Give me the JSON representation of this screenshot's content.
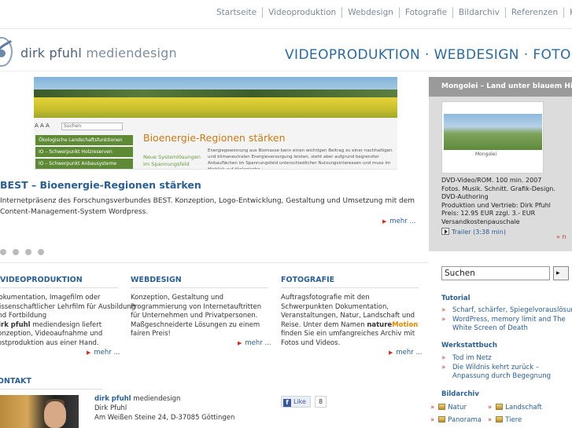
{
  "nav": {
    "items": [
      "Startseite",
      "Videoproduktion",
      "Webdesign",
      "Fotografie",
      "Bildarchiv",
      "Referenzen",
      "Ko"
    ]
  },
  "brand": {
    "name_bold": "dirk pfuhl",
    "name_light": "mediendesign",
    "logo_icon": "leaf-eye-logo"
  },
  "tagline": "VIDEOPRODUKTION · WEBDESIGN · FOTOGRA",
  "banner": {
    "text_size_label": "A A A",
    "search_placeholder": "Suchen",
    "nav_items": [
      "Ökologische Landschaftsfunktionen",
      "IO – Schwerpunkt Holzreserven",
      "IO – Schwerpunkt Anbausysteme"
    ],
    "title": "Bioenergie-Regionen stärken",
    "subtitle": "Neue Systemlösungen im Spannungsfeld",
    "text": "Energiegewinnung aus Biomasse kann einen wichtigen Beitrag zu einer nachhaltigen und klimaneutralen Energieversorgung leisten, steht aber aufgrund begrenzter Anbauflächen im Spannungsfeld unterschiedlicher Nutzungsinteressen und muss im Hinblick auf ökologische"
  },
  "feature": {
    "title": "BEST – Bioenergie-Regionen stärken",
    "body": "Internetpräsenz des Forschungsverbundes BEST. Konzeption, Logo-Entwicklung, Gestaltung und Umsetzung mit dem Content-Management-System Wordpress.",
    "more": "mehr ..."
  },
  "columns": [
    {
      "heading": "VIDEOPRODUKTION",
      "lines": [
        "Dokumentation, Imagefilm oder",
        "wissenschaftlicher Lehrfilm für Ausbildung",
        "und Fortbildung"
      ],
      "brand": "dirk pfuhl",
      "brand_suffix": " mediendesign liefert",
      "lines2": [
        "Konzeption, Videoaufnahme und",
        "Postproduktion aus einer Hand."
      ],
      "more": "mehr ..."
    },
    {
      "heading": "WEBDESIGN",
      "text": "Konzeption, Gestaltung und Programmierung von Internetauftritten für Unternehmen und Privatpersonen. Maßgeschneiderte Lösungen zu einem fairen Preis!",
      "more": "mehr ..."
    },
    {
      "heading": "FOTOGRAFIE",
      "text": "Auftragsfotografie mit den Schwerpunkten Dokumentation, Veranstaltungen, Natur, Landschaft und Reise.",
      "text2_pre": "Unter dem Namen ",
      "text2_brand": "nature",
      "text2_accent": "Motion",
      "text2_post": " finden Sie ein umfangreiches Archiv mit Fotos und Videos.",
      "more": "mehr ..."
    }
  ],
  "contact": {
    "heading": "KONTAKT",
    "brand": "dirk pfuhl",
    "brand_suffix": " mediendesign",
    "name": "Dirk Pfuhl",
    "address": "Am Weißen Steine 24, D-37085 Göttingen",
    "like_label": "Like",
    "like_count": "8"
  },
  "promo": {
    "header": "Mongolei – Land unter blauem Himmel",
    "cover_title": "Mongolei",
    "lines": [
      "DVD-Video/ROM. 100 min. 2007",
      "Fotos. Musik. Schnitt. Grafik-Design. DVD-Authoring",
      "Produktion und Vertrieb: Dirk Pfuhl",
      "Preis: 12.95 EUR zzgl. 3.- EUR Versandkostenpauschale"
    ],
    "trailer": "Trailer (3:38 min)",
    "scroll": "» n"
  },
  "search": {
    "value": "Suchen",
    "button": "▸"
  },
  "sidebar": {
    "tutorial": {
      "heading": "Tutorial",
      "items": [
        "Scharf, schärfer, Spiegelvorauslösung",
        "WordPress, memory limit and The White Screen of Death"
      ]
    },
    "werkstatt": {
      "heading": "Werkstattbuch",
      "items": [
        "Tod im Netz",
        "Die Wildnis kehrt zurück – Anpassung durch Begegnung"
      ]
    },
    "bildarchiv": {
      "heading": "Bildarchiv",
      "items": [
        "Natur",
        "Landschaft",
        "Panorama",
        "Tiere"
      ]
    }
  },
  "colors": {
    "accent": "#2b5f8f",
    "arrow": "#c0392b",
    "banner_green": "#5e8a36",
    "banner_title": "#c97a13",
    "promo_bg": "#dcdcdc"
  }
}
